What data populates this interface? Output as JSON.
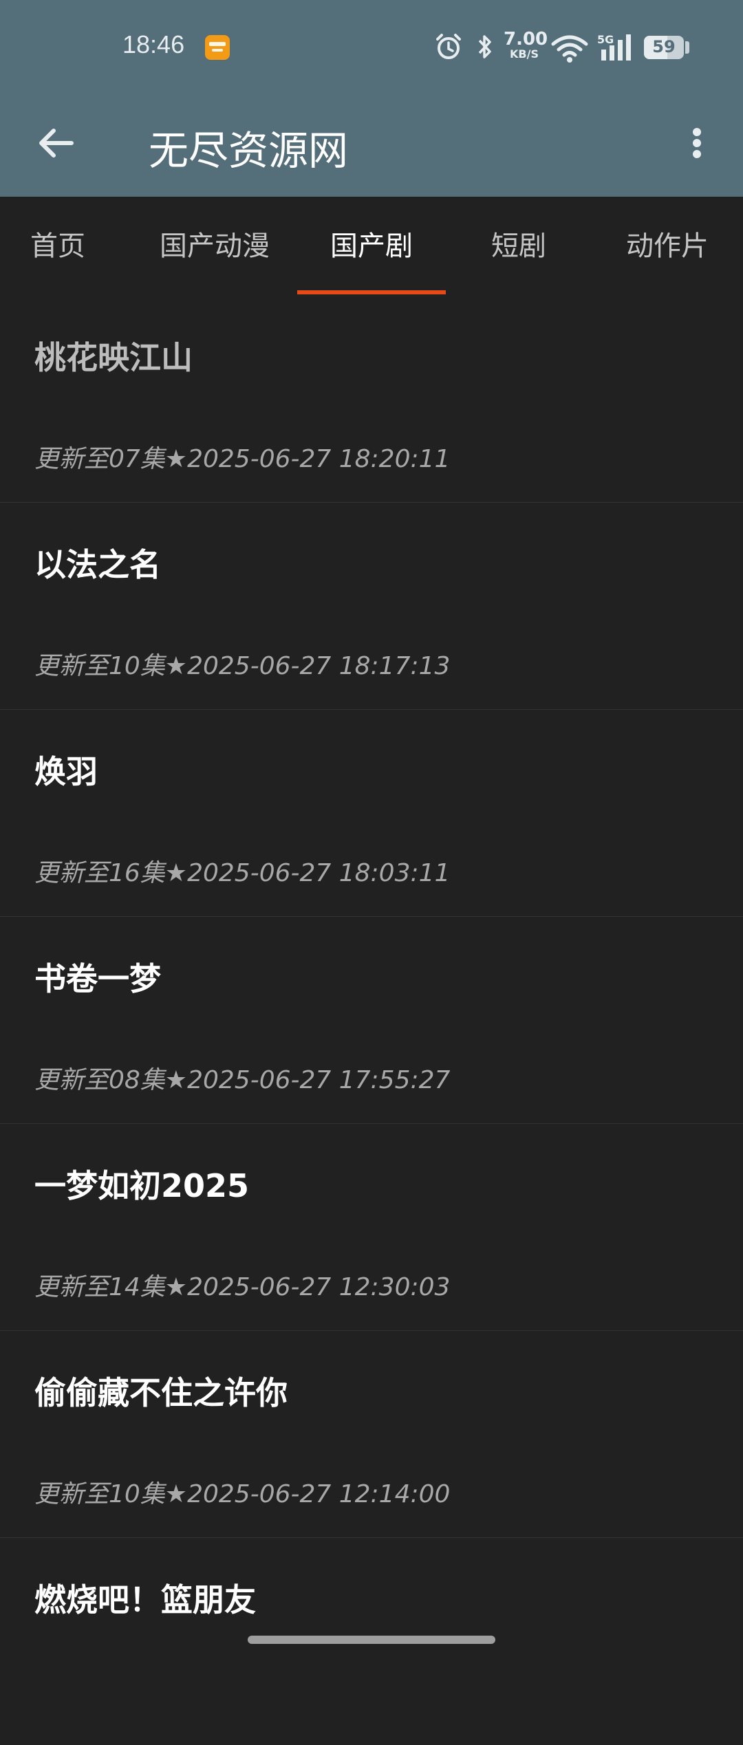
{
  "status_bar": {
    "time": "18:46",
    "net_speed_value": "7.00",
    "net_speed_unit": "KB/S",
    "signal_label": "5G",
    "battery_level": "59",
    "battery_fraction": 0.59
  },
  "app_bar": {
    "title": "无尽资源网"
  },
  "tabs": [
    {
      "label": "首页"
    },
    {
      "label": "国产动漫"
    },
    {
      "label": "国产剧"
    },
    {
      "label": "短剧"
    },
    {
      "label": "动作片"
    }
  ],
  "active_tab": "国产剧",
  "items": [
    {
      "title": "桃花映江山",
      "meta": "更新至07集★2025-06-27 18:20:11"
    },
    {
      "title": "以法之名",
      "meta": "更新至10集★2025-06-27 18:17:13"
    },
    {
      "title": "焕羽",
      "meta": "更新至16集★2025-06-27 18:03:11"
    },
    {
      "title": "书卷一梦",
      "meta": "更新至08集★2025-06-27 17:55:27"
    },
    {
      "title": "一梦如初2025",
      "meta": "更新至14集★2025-06-27 12:30:03"
    },
    {
      "title": "偷偷藏不住之许你",
      "meta": "更新至10集★2025-06-27 12:14:00"
    },
    {
      "title": "燃烧吧！篮朋友",
      "meta": ""
    }
  ],
  "colors": {
    "app_bar": "#546E7A",
    "background": "#212121",
    "accent": "#E64A19"
  }
}
